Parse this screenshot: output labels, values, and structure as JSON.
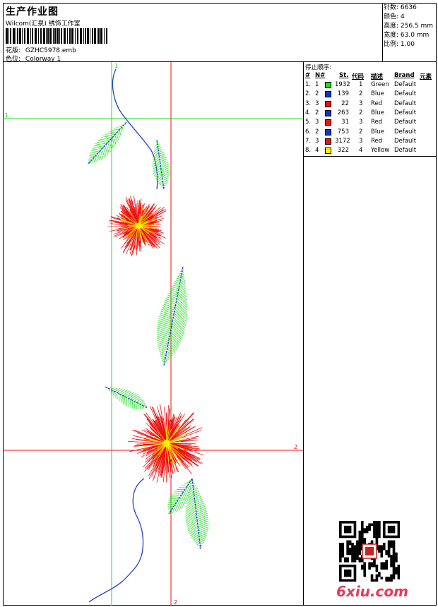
{
  "header": {
    "title": "生产作业图",
    "subtitle": "Wilcom(汇泉) 绣饰工作室",
    "design_label": "花版:",
    "design_value": "GZHC5978.emb",
    "colorway_label": "色位:",
    "colorway_value": "Colorway 1"
  },
  "stats": {
    "stitches": "针数: 6636",
    "colors": "颜色: 4",
    "height": "高度: 256.5 mm",
    "width": "宽度: 63.0 mm",
    "scale": "比例: 1.00"
  },
  "stop_sequence": {
    "title": "停止顺序:",
    "headers": [
      "#",
      "N#",
      "St.",
      "代码",
      "描述",
      "Brand",
      "元素"
    ],
    "rows": [
      {
        "idx": "1.",
        "n": "1",
        "color": "#22dd22",
        "st": "1932",
        "code": "1",
        "desc": "Green",
        "brand": "Default"
      },
      {
        "idx": "2.",
        "n": "2",
        "color": "#1133cc",
        "st": "139",
        "code": "2",
        "desc": "Blue",
        "brand": "Default"
      },
      {
        "idx": "3.",
        "n": "3",
        "color": "#ee1111",
        "st": "22",
        "code": "3",
        "desc": "Red",
        "brand": "Default"
      },
      {
        "idx": "4.",
        "n": "2",
        "color": "#1133cc",
        "st": "263",
        "code": "2",
        "desc": "Blue",
        "brand": "Default"
      },
      {
        "idx": "5.",
        "n": "3",
        "color": "#ee1111",
        "st": "31",
        "code": "3",
        "desc": "Red",
        "brand": "Default"
      },
      {
        "idx": "6.",
        "n": "2",
        "color": "#1133cc",
        "st": "753",
        "code": "2",
        "desc": "Blue",
        "brand": "Default"
      },
      {
        "idx": "7.",
        "n": "3",
        "color": "#ee1111",
        "st": "3172",
        "code": "3",
        "desc": "Red",
        "brand": "Default"
      },
      {
        "idx": "8.",
        "n": "4",
        "color": "#ffee00",
        "st": "322",
        "code": "4",
        "desc": "Yellow",
        "brand": "Default"
      }
    ]
  },
  "guides": {
    "green_label": "1",
    "red_label": "2"
  },
  "watermark": "6xiu.com",
  "colors": {
    "green": "#22dd22",
    "red": "#ee1111",
    "blue": "#1133cc",
    "yellow": "#ffee00"
  }
}
